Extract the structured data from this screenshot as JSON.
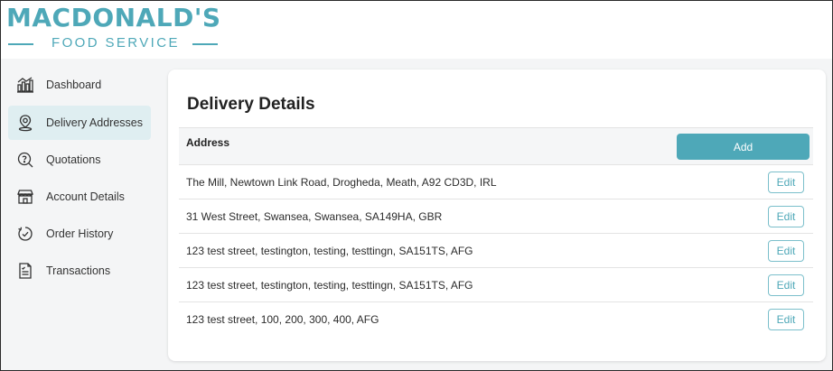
{
  "brand": {
    "title": "MACDONALD'S",
    "subtitle": "FOOD SERVICE",
    "color": "#4ea8b8"
  },
  "sidebar": {
    "items": [
      {
        "label": "Dashboard",
        "icon": "dashboard-icon",
        "active": false
      },
      {
        "label": "Delivery Addresses",
        "icon": "location-pin-icon",
        "active": true
      },
      {
        "label": "Quotations",
        "icon": "quotation-search-icon",
        "active": false
      },
      {
        "label": "Account Details",
        "icon": "storefront-icon",
        "active": false
      },
      {
        "label": "Order History",
        "icon": "order-history-icon",
        "active": false
      },
      {
        "label": "Transactions",
        "icon": "receipt-icon",
        "active": false
      }
    ]
  },
  "main": {
    "title": "Delivery Details",
    "table": {
      "header_address": "Address",
      "add_label": "Add",
      "edit_label": "Edit",
      "rows": [
        {
          "address": "The Mill, Newtown Link Road, Drogheda, Meath, A92 CD3D, IRL"
        },
        {
          "address": "31 West Street, Swansea, Swansea, SA149HA, GBR"
        },
        {
          "address": "123 test street, testington, testing, testtingn, SA151TS, AFG"
        },
        {
          "address": "123 test street, testington, testing, testtingn, SA151TS, AFG"
        },
        {
          "address": "123 test street, 100, 200, 300, 400, AFG"
        }
      ]
    }
  }
}
